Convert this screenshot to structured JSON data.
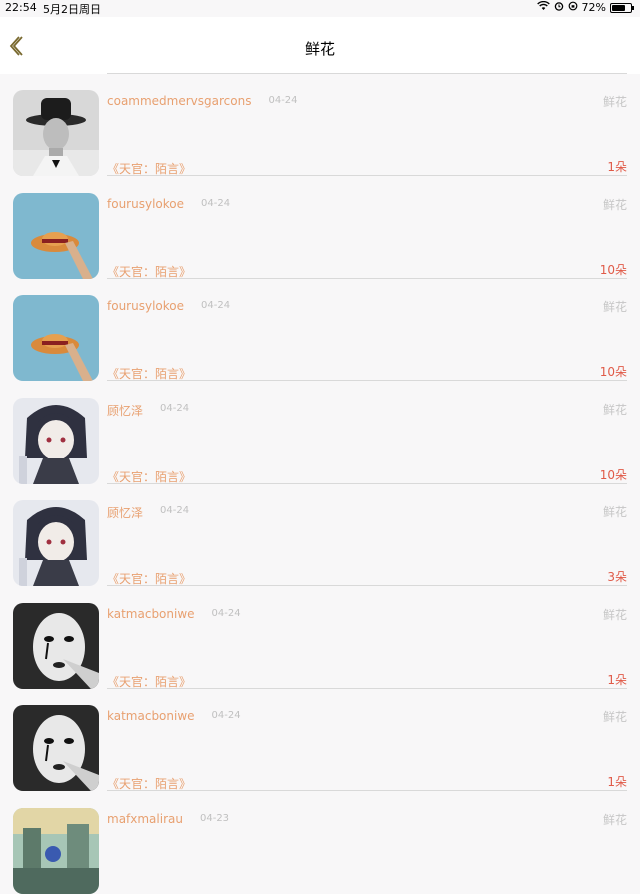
{
  "status_bar": {
    "time": "22:54",
    "date": "5月2日周日",
    "battery": "72%",
    "battery_level": 0.72
  },
  "nav": {
    "title": "鲜花",
    "back_icon": "chevron-left-icon"
  },
  "items": [
    {
      "username": "coammedmervsgarcons",
      "date": "04-24",
      "tag": "鲜花",
      "work": "《天官：陌言》",
      "count": "1朵",
      "avatar": "man-in-hat"
    },
    {
      "username": "fourusylokoe",
      "date": "04-24",
      "tag": "鲜花",
      "work": "《天官：陌言》",
      "count": "10朵",
      "avatar": "straw-hat"
    },
    {
      "username": "fourusylokoe",
      "date": "04-24",
      "tag": "鲜花",
      "work": "《天官：陌言》",
      "count": "10朵",
      "avatar": "straw-hat"
    },
    {
      "username": "顾忆泽",
      "date": "04-24",
      "tag": "鲜花",
      "work": "《天官：陌言》",
      "count": "10朵",
      "avatar": "anime-girl"
    },
    {
      "username": "顾忆泽",
      "date": "04-24",
      "tag": "鲜花",
      "work": "《天官：陌言》",
      "count": "3朵",
      "avatar": "anime-girl"
    },
    {
      "username": "katmacboniwe",
      "date": "04-24",
      "tag": "鲜花",
      "work": "《天官：陌言》",
      "count": "1朵",
      "avatar": "mime-face"
    },
    {
      "username": "katmacboniwe",
      "date": "04-24",
      "tag": "鲜花",
      "work": "《天官：陌言》",
      "count": "1朵",
      "avatar": "mime-face"
    },
    {
      "username": "mafxmalirau",
      "date": "04-23",
      "tag": "鲜花",
      "work": "",
      "count": "",
      "avatar": "street-scene"
    }
  ]
}
